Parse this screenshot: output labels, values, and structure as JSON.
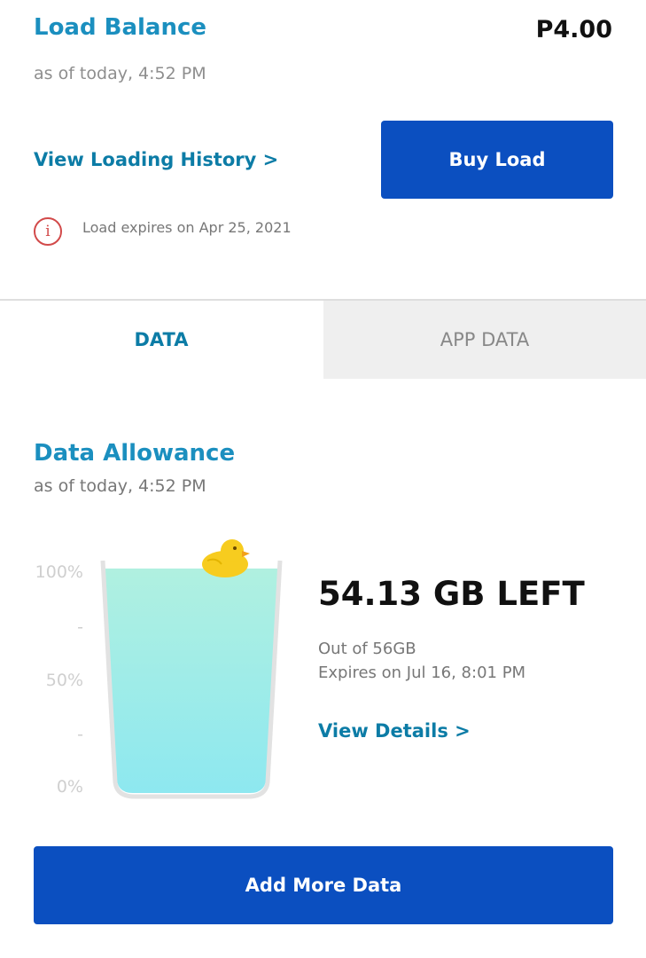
{
  "load": {
    "title": "Load Balance",
    "amount": "P4.00",
    "as_of": "as of today, 4:52 PM",
    "history_link": "View Loading History >",
    "buy_button": "Buy Load",
    "expiry_note": "Load expires on Apr 25, 2021",
    "info_icon_glyph": "i"
  },
  "tabs": [
    {
      "label": "DATA",
      "active": true
    },
    {
      "label": "APP DATA",
      "active": false
    }
  ],
  "allowance": {
    "title": "Data Allowance",
    "as_of": "as of today, 4:52 PM",
    "scale": [
      "100%",
      "-",
      "50%",
      "-",
      "0%"
    ],
    "remaining": "54.13 GB LEFT",
    "total": "Out of 56GB",
    "expiry": "Expires on Jul 16, 8:01 PM",
    "details_link": "View Details >",
    "fill_fraction": 0.966
  },
  "add_button": "Add More Data",
  "colors": {
    "accent_blue": "#0b4fc0",
    "title_teal": "#1b8fbf",
    "water_top": "#b0f0e0",
    "water_bottom": "#8de8f0",
    "warning_red": "#d24a4a"
  }
}
